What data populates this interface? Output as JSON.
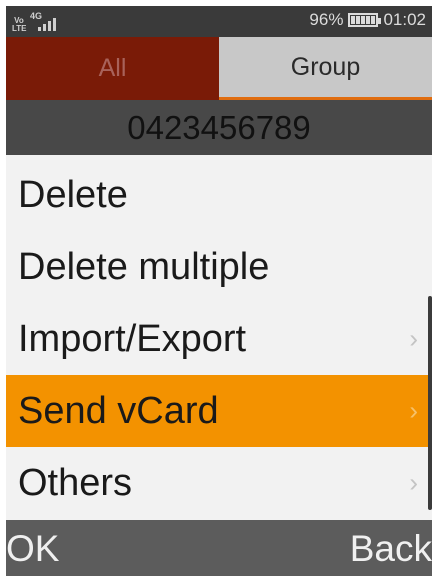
{
  "status_bar": {
    "volte": "Vo LTE",
    "network": "4G",
    "signal_bars": 4,
    "battery_percent": "96%",
    "battery_level": 0.96,
    "time": "01:02"
  },
  "tabs": [
    {
      "label": "All",
      "active": false
    },
    {
      "label": "Group",
      "active": true
    }
  ],
  "contact_number": "0423456789",
  "menu": {
    "items": [
      {
        "label": "Delete",
        "has_submenu": false
      },
      {
        "label": "Delete multiple",
        "has_submenu": false
      },
      {
        "label": "Import/Export",
        "has_submenu": true
      },
      {
        "label": "Send vCard",
        "has_submenu": true,
        "selected": true
      },
      {
        "label": "Others",
        "has_submenu": true
      }
    ],
    "chevron": "›",
    "selected_color": "#f39200"
  },
  "softkeys": {
    "left": "OK",
    "right": "Back"
  }
}
